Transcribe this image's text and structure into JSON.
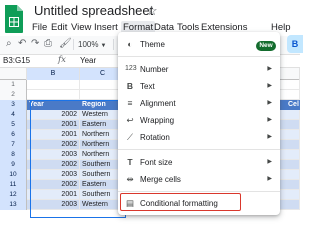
{
  "app": {
    "title": "Untitled spreadsheet",
    "logo_icon": "sheets-logo-icon",
    "star_icon": "star-outline-icon",
    "menubar": [
      "File",
      "Edit",
      "View",
      "Insert",
      "Format",
      "Data",
      "Tools",
      "Extensions",
      "Help"
    ],
    "active_menu": "Format"
  },
  "toolbar": {
    "icons": [
      "search-icon",
      "undo-icon",
      "redo-icon",
      "print-icon",
      "paint-format-icon"
    ],
    "zoom": "100%",
    "share_glyph": "B"
  },
  "formula_bar": {
    "name_box": "B3:G15",
    "fx": "fx",
    "value": "Year"
  },
  "grid": {
    "columns": [
      "",
      "B",
      "C",
      "",
      "",
      "",
      "",
      "",
      ""
    ],
    "visible_column_letters": [
      "B",
      "C"
    ],
    "rows": [
      "1",
      "2",
      "3",
      "4",
      "5",
      "6",
      "7",
      "8",
      "9",
      "10",
      "11",
      "12",
      "13"
    ],
    "header": {
      "year": "Year",
      "region": "Region",
      "extra": "Cel"
    },
    "data": [
      {
        "year": "2002",
        "region": "Western"
      },
      {
        "year": "2001",
        "region": "Eastern"
      },
      {
        "year": "2001",
        "region": "Northern"
      },
      {
        "year": "2002",
        "region": "Northern"
      },
      {
        "year": "2003",
        "region": "Northern"
      },
      {
        "year": "2002",
        "region": "Southern"
      },
      {
        "year": "2003",
        "region": "Southern"
      },
      {
        "year": "2002",
        "region": "Eastern"
      },
      {
        "year": "2001",
        "region": "Southern"
      },
      {
        "year": "2003",
        "region": "Western"
      }
    ],
    "colors": {
      "header": "#4a7ac7",
      "band_a": "#e3ecfa",
      "band_b": "#cfdcf2",
      "selection": "#1a73e8"
    }
  },
  "format_menu": {
    "theme": {
      "label": "Theme",
      "icon": "palette-icon",
      "badge": "New"
    },
    "items": [
      {
        "label": "Number",
        "icon": "number-123-icon"
      },
      {
        "label": "Text",
        "icon": "bold-b-icon"
      },
      {
        "label": "Alignment",
        "icon": "align-left-icon"
      },
      {
        "label": "Wrapping",
        "icon": "wrap-text-icon"
      },
      {
        "label": "Rotation",
        "icon": "text-rotation-icon"
      }
    ],
    "items2": [
      {
        "label": "Font size",
        "icon": "font-size-icon"
      },
      {
        "label": "Merge cells",
        "icon": "merge-cells-icon"
      }
    ],
    "conditional": {
      "label": "Conditional formatting",
      "icon": "paint-roller-icon"
    },
    "highlight_color": "#d9372c",
    "submenu_arrow_icon": "triangle-right-icon"
  }
}
